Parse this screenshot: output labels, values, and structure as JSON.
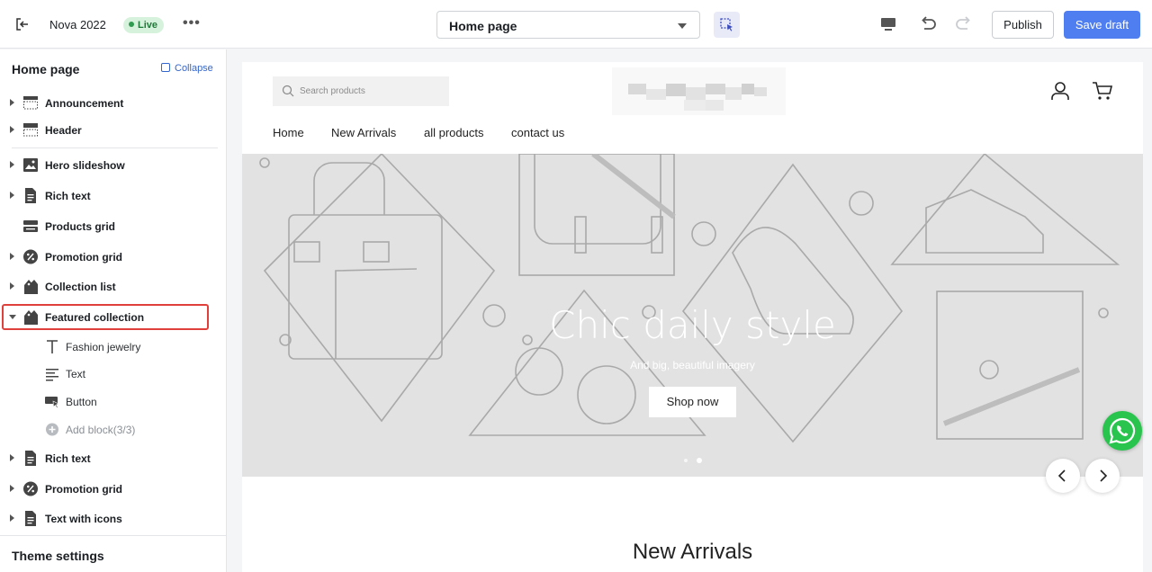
{
  "topbar": {
    "store_name": "Nova 2022",
    "live_badge": "Live",
    "more_label": "•••",
    "page_select": "Home page",
    "publish_label": "Publish",
    "save_label": "Save draft"
  },
  "sidebar": {
    "title": "Home page",
    "collapse_label": "Collapse",
    "items": [
      {
        "label": "Announcement",
        "icon": "section-layout-icon"
      },
      {
        "label": "Header",
        "icon": "header-layout-icon"
      },
      {
        "label": "Hero slideshow",
        "icon": "image-icon"
      },
      {
        "label": "Rich text",
        "icon": "document-icon"
      },
      {
        "label": "Products grid",
        "icon": "grid-icon"
      },
      {
        "label": "Promotion grid",
        "icon": "discount-icon"
      },
      {
        "label": "Collection list",
        "icon": "tag-icon"
      },
      {
        "label": "Featured collection",
        "icon": "tag-icon"
      }
    ],
    "blocks": [
      {
        "label": "Fashion jewelry",
        "icon": "text-icon"
      },
      {
        "label": "Text",
        "icon": "paragraph-icon"
      },
      {
        "label": "Button",
        "icon": "button-icon"
      },
      {
        "label": "Add block(3/3)",
        "icon": "add-icon"
      }
    ],
    "items_after": [
      {
        "label": "Rich text",
        "icon": "document-icon"
      },
      {
        "label": "Promotion grid",
        "icon": "discount-icon"
      },
      {
        "label": "Text with icons",
        "icon": "document-icon"
      }
    ],
    "theme_settings": "Theme settings"
  },
  "preview": {
    "search_placeholder": "Search products",
    "nav": [
      "Home",
      "New Arrivals",
      "all products",
      "contact us"
    ],
    "hero_title": "Chic daily style",
    "hero_subtitle": "And big, beautiful imagery",
    "hero_button": "Shop now",
    "section_title": "New Arrivals"
  },
  "colors": {
    "accent": "#4f7ef0",
    "highlight": "#e0403b",
    "live": "#2e9b50",
    "whatsapp": "#29c44e"
  }
}
